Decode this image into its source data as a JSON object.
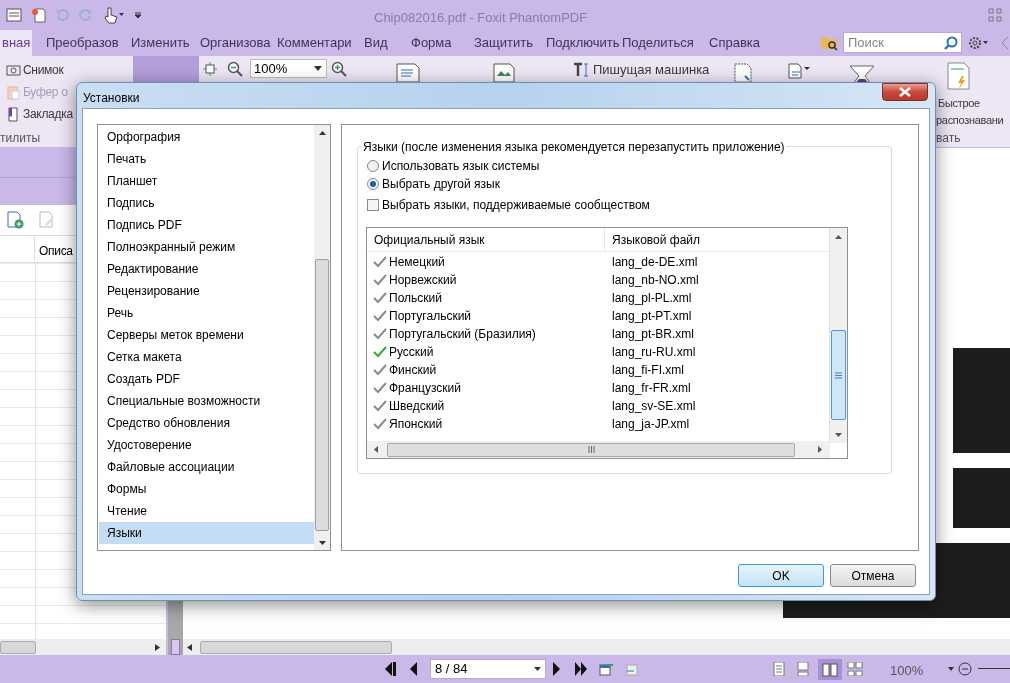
{
  "app": {
    "title": "Chip082016.pdf - Foxit PhantomPDF",
    "menu_tabs": [
      {
        "label": "вная",
        "selected": true
      },
      {
        "label": "Преобразов",
        "selected": false
      },
      {
        "label": "Изменить",
        "selected": false
      },
      {
        "label": "Организова",
        "selected": false
      },
      {
        "label": "Комментари",
        "selected": false
      },
      {
        "label": "Вид",
        "selected": false
      },
      {
        "label": "Форма",
        "selected": false
      },
      {
        "label": "Защитить",
        "selected": false
      },
      {
        "label": "Подключить",
        "selected": false
      },
      {
        "label": "Поделиться",
        "selected": false
      },
      {
        "label": "Справка",
        "selected": false
      }
    ],
    "search": {
      "placeholder": "Поиск"
    },
    "ribbon_left": [
      {
        "kind": "camera",
        "label": "Снимок",
        "disabled": false
      },
      {
        "kind": "clipboard",
        "label": "Буфер о",
        "disabled": true
      },
      {
        "kind": "bookmark",
        "label": "Закладка",
        "disabled": false
      }
    ],
    "ribbon_group_label": "тилиты",
    "zoom_combo": "100%",
    "typewriter": "Пишущая машинка",
    "ocr_label": [
      "Быстрое",
      "распознавани"
    ],
    "ocr_group_label": "вать",
    "panel_column": "Описа",
    "page_field": "8 / 84",
    "zoom_reading": "100%"
  },
  "dialog": {
    "title": "Установки",
    "categories": [
      {
        "label": "Орфография",
        "selected": false
      },
      {
        "label": "Печать",
        "selected": false
      },
      {
        "label": "Планшет",
        "selected": false
      },
      {
        "label": "Подпись",
        "selected": false
      },
      {
        "label": "Подпись PDF",
        "selected": false
      },
      {
        "label": "Полноэкранный режим",
        "selected": false
      },
      {
        "label": "Редактирование",
        "selected": false
      },
      {
        "label": "Рецензирование",
        "selected": false
      },
      {
        "label": "Речь",
        "selected": false
      },
      {
        "label": "Серверы меток времени",
        "selected": false
      },
      {
        "label": "Сетка макета",
        "selected": false
      },
      {
        "label": "Создать PDF",
        "selected": false
      },
      {
        "label": "Специальные возможности",
        "selected": false
      },
      {
        "label": "Средство обновления",
        "selected": false
      },
      {
        "label": "Удостоверение",
        "selected": false
      },
      {
        "label": "Файловые ассоциации",
        "selected": false
      },
      {
        "label": "Формы",
        "selected": false
      },
      {
        "label": "Чтение",
        "selected": false
      },
      {
        "label": "Языки",
        "selected": true
      }
    ],
    "group_title": "Языки (после изменения языка рекомендуется перезапустить приложение)",
    "radios": [
      {
        "label": "Использовать язык системы",
        "selected": false
      },
      {
        "label": "Выбрать другой язык",
        "selected": true
      }
    ],
    "community_checkbox": {
      "label": "Выбрать языки, поддерживаемые сообществом",
      "checked": false
    },
    "table": {
      "columns": [
        "Официальный язык",
        "Языковой файл"
      ],
      "rows": [
        {
          "language": "Немецкий",
          "file": "lang_de-DE.xml",
          "active": false
        },
        {
          "language": "Норвежский",
          "file": "lang_nb-NO.xml",
          "active": false
        },
        {
          "language": "Польский",
          "file": "lang_pl-PL.xml",
          "active": false
        },
        {
          "language": "Португальский",
          "file": "lang_pt-PT.xml",
          "active": false
        },
        {
          "language": "Португальский (Бразилия)",
          "file": "lang_pt-BR.xml",
          "active": false
        },
        {
          "language": "Русский",
          "file": "lang_ru-RU.xml",
          "active": true
        },
        {
          "language": "Финский",
          "file": "lang_fi-FI.xml",
          "active": false
        },
        {
          "language": "Французский",
          "file": "lang_fr-FR.xml",
          "active": false
        },
        {
          "language": "Шведский",
          "file": "lang_sv-SE.xml",
          "active": false
        },
        {
          "language": "Японский",
          "file": "lang_ja-JP.xml",
          "active": false
        }
      ]
    },
    "buttons": [
      {
        "label": "OK",
        "kind": "default"
      },
      {
        "label": "Отмена",
        "kind": "normal"
      }
    ]
  }
}
